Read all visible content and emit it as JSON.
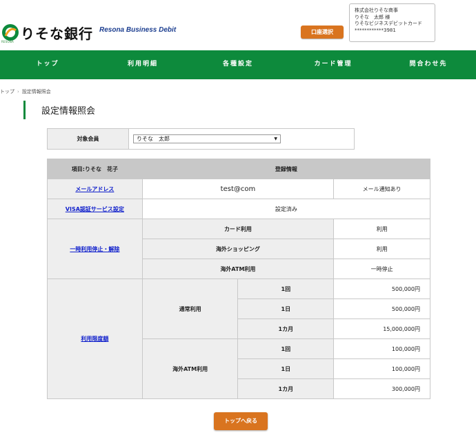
{
  "header": {
    "bank_name": "りそな銀行",
    "logo_sub": "RESONA",
    "brand": "Resona Business Debit",
    "account_select_label": "口座選択",
    "user": {
      "company": "株式会社りそな商事",
      "name": "りそな　太郎 様",
      "card_name": "りそなビジネスデビットカード",
      "card_number": "************3981"
    }
  },
  "nav": {
    "items": [
      {
        "label": "トップ"
      },
      {
        "label": "利用明細"
      },
      {
        "label": "各種設定"
      },
      {
        "label": "カード管理"
      },
      {
        "label": "問合わせ先"
      }
    ]
  },
  "breadcrumb": {
    "items": [
      "トップ",
      "設定情報照会"
    ]
  },
  "page_title": "設定情報照会",
  "member": {
    "label": "対象会員",
    "selected": "りそな　太郎"
  },
  "table": {
    "header_item": "項目:りそな　花子",
    "header_info": "登録情報",
    "email": {
      "label": "メールアドレス",
      "value": "test@com",
      "notice": "メール通知あり"
    },
    "visa": {
      "label": "VISA認証サービス設定",
      "value": "設定済み"
    },
    "suspend": {
      "label": "一時利用停止・解除",
      "rows": [
        {
          "label": "カード利用",
          "value": "利用"
        },
        {
          "label": "海外ショッピング",
          "value": "利用"
        },
        {
          "label": "海外ATM利用",
          "value": "一時停止"
        }
      ]
    },
    "limit": {
      "label": "利用限度額",
      "groups": [
        {
          "label": "通常利用",
          "rows": [
            {
              "period": "1回",
              "amount": "500,000円"
            },
            {
              "period": "1日",
              "amount": "500,000円"
            },
            {
              "period": "1カ月",
              "amount": "15,000,000円"
            }
          ]
        },
        {
          "label": "海外ATM利用",
          "rows": [
            {
              "period": "1回",
              "amount": "100,000円"
            },
            {
              "period": "1日",
              "amount": "100,000円"
            },
            {
              "period": "1カ月",
              "amount": "300,000円"
            }
          ]
        }
      ]
    }
  },
  "back_button": "トップへ戻る",
  "colors": {
    "nav_green": "#0d8a3c",
    "button_orange": "#d9741f",
    "link_blue": "#1020cc"
  }
}
